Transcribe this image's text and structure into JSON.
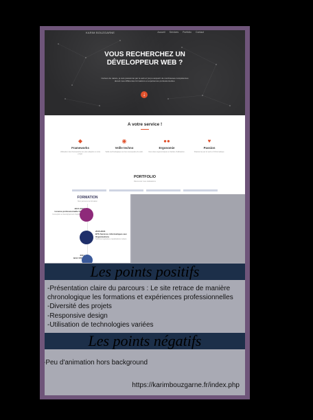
{
  "hero": {
    "nav_name": "KARIM BOUZGARNE",
    "nav_links": [
      "Accueil",
      "Services",
      "Portfolio",
      "Contact"
    ],
    "title_line1": "VOUS RECHERCHEZ UN",
    "title_line2": "DÉVELOPPEUR WEB ?",
    "subtitle": "Curieux de nature, je suis passionné par le web et j'ai pu acquérir de nombreuses compétences durant mes différentes formations et expériences professionnelles.",
    "down_icon": "arrow-down-icon"
  },
  "service": {
    "title": "A votre service !",
    "items": [
      {
        "icon": "diamond-icon",
        "name": "Frameworks",
        "desc": "Utilisation des frameworks les plus adaptés à votre projet."
      },
      {
        "icon": "eye-icon",
        "name": "Veille techno",
        "desc": "Veille technologique sur les nouveautés du web."
      },
      {
        "icon": "users-icon",
        "name": "Ergonomie",
        "desc": "Des sites ergonomiques et faciles d'utilisation."
      },
      {
        "icon": "heart-icon",
        "name": "Passion",
        "desc": "Passionné par le web et l'informatique."
      }
    ],
    "portfolio_title": "PORTFOLIO",
    "portfolio_sub": "Découvrez mes réalisations"
  },
  "formation": {
    "title": "FORMATION",
    "subtitle": "Mon parcours de formation",
    "entries": [
      {
        "year": "2017-2018",
        "title": "Licence professionnelle CDUP",
        "desc": "Conception et développement d'applications web"
      },
      {
        "year": "2015-2016",
        "title": "BTS Services informatiques aux Organisations",
        "desc": "Solutions logicielles et applications métiers"
      },
      {
        "year": "2011",
        "title": "BAC STI2D",
        "desc": ""
      }
    ]
  },
  "positifs": {
    "heading": "Les points positifs",
    "items": [
      "-Présentation claire du parcours : Le site retrace de manière",
      "chronologique les formations et expériences professionnelles",
      "-Diversité des projets",
      "-Responsive design",
      "-Utilisation de technologies variées"
    ]
  },
  "negatifs": {
    "heading": "Les points négatifs",
    "items": [
      "-Peu d'animation hors background"
    ]
  },
  "url": "https://karimbouzgarne.fr/index.php",
  "colors": {
    "frame": "#6f557a",
    "accent": "#e0512c",
    "banner": "#1c2f49",
    "panel": "#a9aab4"
  }
}
